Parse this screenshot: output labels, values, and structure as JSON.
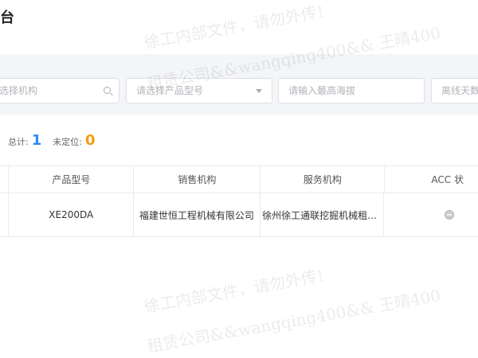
{
  "header": {
    "title": "台"
  },
  "filters": {
    "org_placeholder": "选择机构",
    "model_placeholder": "请选择产品型号",
    "altitude_placeholder": "请输入最高海拔",
    "offline_days_placeholder": "离线天数"
  },
  "icons": {
    "search": "search-icon",
    "caret": "caret-down-icon",
    "acc_status": "acc-status-icon"
  },
  "summary": {
    "total_label": "总计:",
    "total_value": "1",
    "unlocated_label": "未定位:",
    "unlocated_value": "0",
    "total_color": "#2d8cf0",
    "unlocated_color": "#f39c12"
  },
  "table": {
    "columns": [
      "产品型号",
      "销售机构",
      "服务机构",
      "ACC 状"
    ],
    "rows": [
      {
        "model": "XE200DA",
        "sales_org": "福建世恒工程机械有限公司",
        "service_org": "徐州徐工通联挖掘机械租赁..."
      }
    ]
  },
  "watermark": {
    "line1": "徐工内部文件，请勿外传！",
    "line2": "租赁公司&&wangqing400&& 王晴400"
  }
}
